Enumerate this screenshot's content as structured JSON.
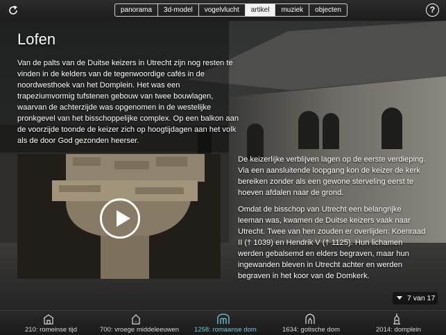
{
  "toolbar": {
    "tabs": [
      {
        "label": "panorama"
      },
      {
        "label": "3d-model"
      },
      {
        "label": "vogelvlucht"
      },
      {
        "label": "artikel"
      },
      {
        "label": "muziek"
      },
      {
        "label": "objecten"
      }
    ],
    "active_tab": "artikel",
    "help_label": "?"
  },
  "article": {
    "title": "Lofen",
    "paragraph1": "Van de palts van de Duitse keizers in Utrecht zijn nog resten te vinden in de kelders van de tegenwoordige cafés in de noordwesthoek van het Domplein. Het was een trapeziumvormig tufstenen gebouw van twee bouwlagen, waarvan de achterzijde was opgenomen in de westelijke pronkgevel van het bisschoppelijke complex. Op een balkon aan de voorzijde toonde de keizer zich op hoogtijdagen aan het volk als de door God gezonden heerser.",
    "paragraph2": "De keizerlijke verblijven lagen op de eerste verdieping. Via een aansluitende loopgang kon de keizer de kerk bereiken zonder als een gewone sterveling eerst te hoeven afdalen naar de grond.",
    "paragraph3": "Omdat de bisschop van Utrecht een belangrijke leeman was, kwamen de Duitse keizers vaak naar Utrecht. Twee van hen zouden er overlijden: Koenraad II († 1039) en Hendrik V († 1125). Hun lichamen werden gebalsemd en elders begraven, maar hun ingewanden bleven in Utrecht achter en werden begraven in het koor van de Domkerk."
  },
  "pager": {
    "label": "7 van 17"
  },
  "timeline": [
    {
      "label": "210: romeinse tijd",
      "icon": "roman-building-icon"
    },
    {
      "label": "700: vroege middeleeuwen",
      "icon": "early-church-icon"
    },
    {
      "label": "1258: romaanse dom",
      "icon": "romanesque-arch-icon"
    },
    {
      "label": "1634: gotische dom",
      "icon": "gothic-arch-icon"
    },
    {
      "label": "2014: domplein",
      "icon": "dom-tower-icon"
    }
  ],
  "active_era": "1258: romaanse dom",
  "colors": {
    "active_era": "#6ecde0",
    "active_tab_bg": "#f2f2f2"
  }
}
